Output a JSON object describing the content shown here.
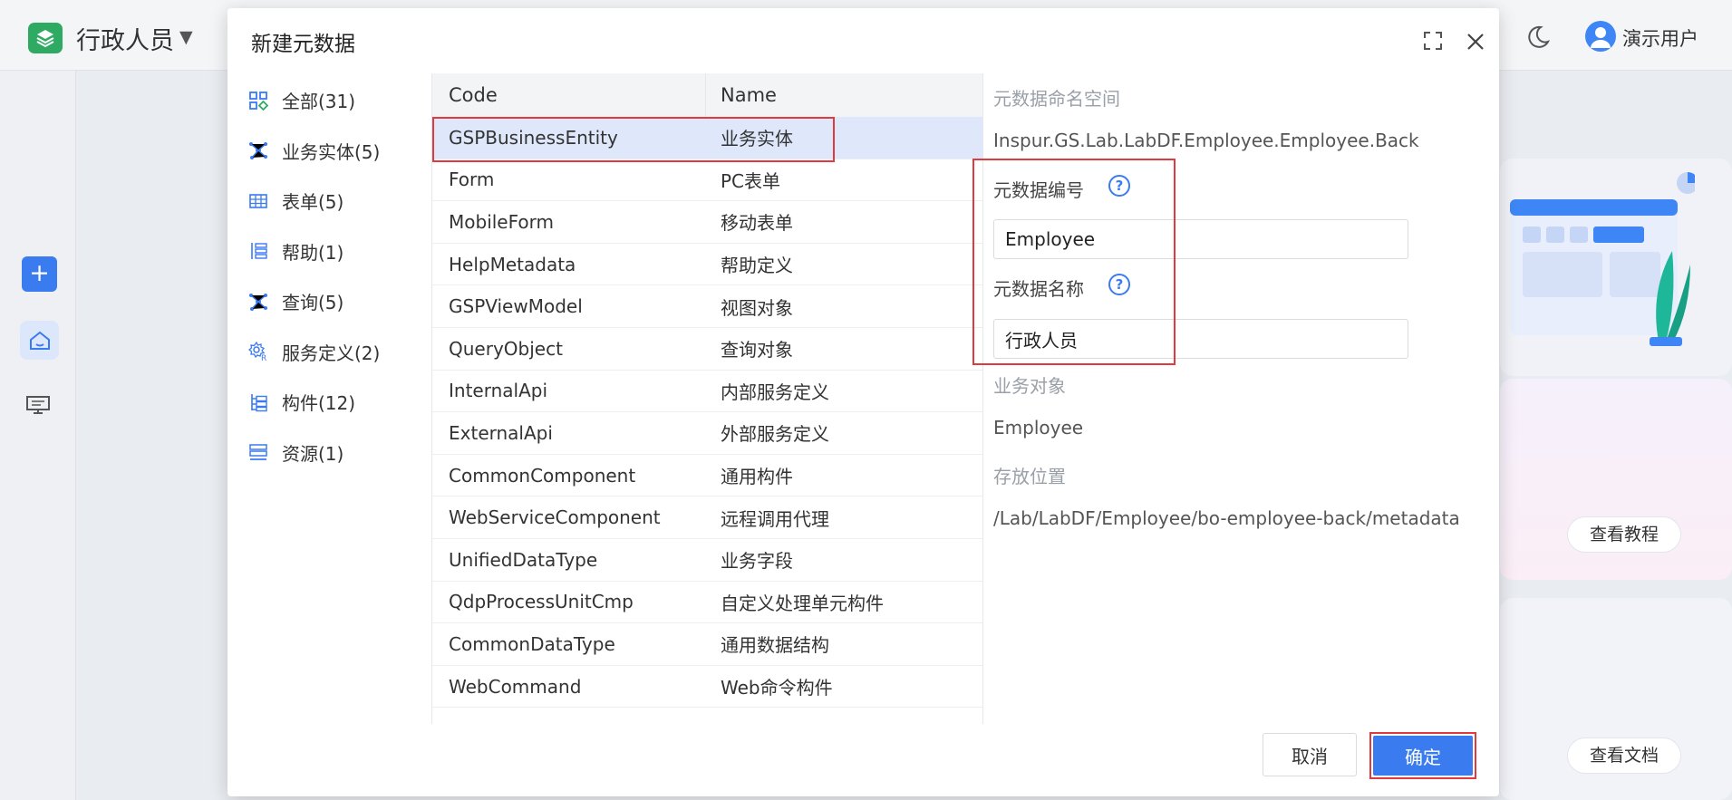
{
  "app": {
    "title": "行政人员",
    "title_arrow": "▼",
    "user_name": "演示用户"
  },
  "side_rail": {
    "add_label": "+"
  },
  "cards": {
    "tutorial_label": "查看教程",
    "docs_label": "查看文档"
  },
  "dialog": {
    "title": "新建元数据",
    "categories": [
      {
        "label": "全部(31)",
        "icon": "grid-icon"
      },
      {
        "label": "业务实体(5)",
        "icon": "network-icon"
      },
      {
        "label": "表单(5)",
        "icon": "table-icon"
      },
      {
        "label": "帮助(1)",
        "icon": "help-list-icon"
      },
      {
        "label": "查询(5)",
        "icon": "query-network-icon"
      },
      {
        "label": "服务定义(2)",
        "icon": "service-gear-icon"
      },
      {
        "label": "构件(12)",
        "icon": "component-tree-icon"
      },
      {
        "label": "资源(1)",
        "icon": "resource-icon"
      }
    ],
    "table": {
      "headers": {
        "code": "Code",
        "name": "Name"
      },
      "rows": [
        {
          "code": "GSPBusinessEntity",
          "name": "业务实体"
        },
        {
          "code": "Form",
          "name": "PC表单"
        },
        {
          "code": "MobileForm",
          "name": "移动表单"
        },
        {
          "code": "HelpMetadata",
          "name": "帮助定义"
        },
        {
          "code": "GSPViewModel",
          "name": "视图对象"
        },
        {
          "code": "QueryObject",
          "name": "查询对象"
        },
        {
          "code": "InternalApi",
          "name": "内部服务定义"
        },
        {
          "code": "ExternalApi",
          "name": "外部服务定义"
        },
        {
          "code": "CommonComponent",
          "name": "通用构件"
        },
        {
          "code": "WebServiceComponent",
          "name": "远程调用代理"
        },
        {
          "code": "UnifiedDataType",
          "name": "业务字段"
        },
        {
          "code": "QdpProcessUnitCmp",
          "name": "自定义处理单元构件"
        },
        {
          "code": "CommonDataType",
          "name": "通用数据结构"
        },
        {
          "code": "WebCommand",
          "name": "Web命令构件"
        }
      ]
    },
    "props": {
      "namespace_label": "元数据命名空间",
      "namespace_value": "Inspur.GS.Lab.LabDF.Employee.Employee.Back",
      "code_label": "元数据编号",
      "code_value": "Employee",
      "name_label": "元数据名称",
      "name_value": "行政人员",
      "bizobj_label": "业务对象",
      "bizobj_value": "Employee",
      "location_label": "存放位置",
      "location_value": "/Lab/LabDF/Employee/bo-employee-back/metadata",
      "help_glyph": "?"
    },
    "buttons": {
      "cancel": "取消",
      "ok": "确定"
    }
  },
  "colors": {
    "accent": "#3a7bf0",
    "highlight_border": "#e0393e",
    "selected_row": "#dfe8fb"
  }
}
